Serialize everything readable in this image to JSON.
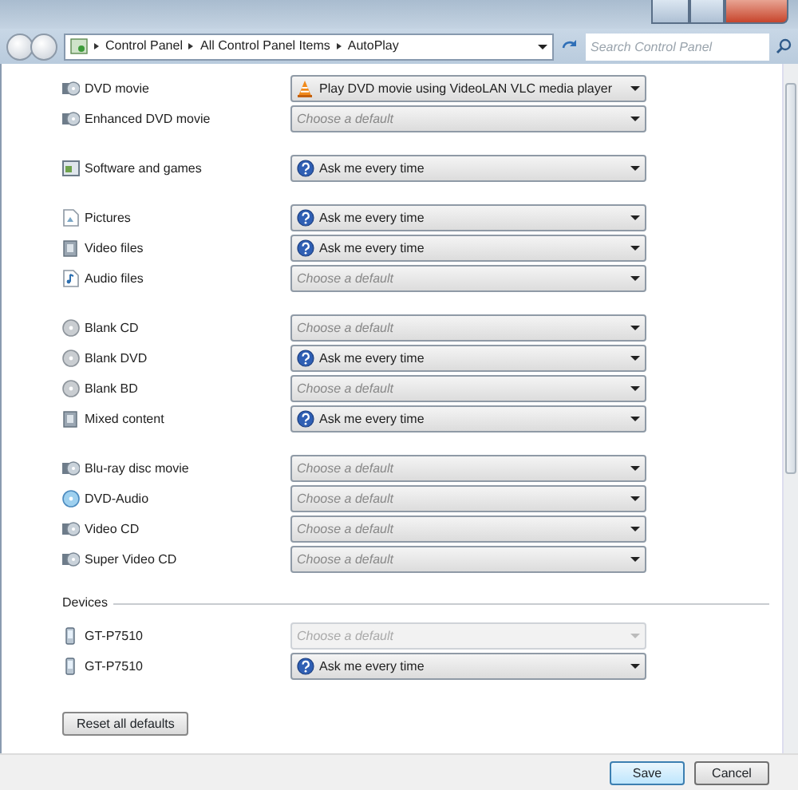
{
  "address_bar": {
    "breadcrumbs": [
      "Control Panel",
      "All Control Panel Items",
      "AutoPlay"
    ],
    "search": {
      "placeholder": "Search Control Panel"
    }
  },
  "groups": [
    {
      "items": [
        {
          "label": "DVD movie",
          "kind": "disc",
          "select": {
            "value": "Play DVD movie using VideoLAN VLC media player",
            "kind": "vlc",
            "disabled": false
          }
        },
        {
          "label": "Enhanced DVD movie",
          "kind": "disc",
          "select": {
            "placeholder": "Choose a default",
            "kind": "none",
            "disabled": false
          }
        }
      ]
    },
    {
      "items": [
        {
          "label": "Software and games",
          "kind": "software",
          "select": {
            "value": "Ask me every time",
            "kind": "ask",
            "disabled": false
          }
        }
      ]
    },
    {
      "items": [
        {
          "label": "Pictures",
          "kind": "picture",
          "select": {
            "value": "Ask me every time",
            "kind": "ask",
            "disabled": false
          }
        },
        {
          "label": "Video files",
          "kind": "video",
          "select": {
            "value": "Ask me every time",
            "kind": "ask",
            "disabled": false
          }
        },
        {
          "label": "Audio files",
          "kind": "audio",
          "select": {
            "placeholder": "Choose a default",
            "kind": "none",
            "disabled": false
          }
        }
      ]
    },
    {
      "items": [
        {
          "label": "Blank CD",
          "kind": "blank",
          "select": {
            "placeholder": "Choose a default",
            "kind": "none",
            "disabled": false
          }
        },
        {
          "label": "Blank DVD",
          "kind": "blank",
          "select": {
            "value": "Ask me every time",
            "kind": "ask",
            "disabled": false
          }
        },
        {
          "label": "Blank BD",
          "kind": "blank",
          "select": {
            "placeholder": "Choose a default",
            "kind": "none",
            "disabled": false
          }
        },
        {
          "label": "Mixed content",
          "kind": "video",
          "select": {
            "value": "Ask me every time",
            "kind": "ask",
            "disabled": false
          }
        }
      ]
    },
    {
      "items": [
        {
          "label": "Blu-ray disc movie",
          "kind": "disc",
          "select": {
            "placeholder": "Choose a default",
            "kind": "none",
            "disabled": false
          }
        },
        {
          "label": "DVD-Audio",
          "kind": "audiodisc",
          "select": {
            "placeholder": "Choose a default",
            "kind": "none",
            "disabled": false
          }
        },
        {
          "label": "Video CD",
          "kind": "disc",
          "select": {
            "placeholder": "Choose a default",
            "kind": "none",
            "disabled": false
          }
        },
        {
          "label": "Super Video CD",
          "kind": "disc",
          "select": {
            "placeholder": "Choose a default",
            "kind": "none",
            "disabled": false
          }
        }
      ]
    },
    {
      "heading": "Devices",
      "items": [
        {
          "label": "GT-P7510",
          "kind": "device",
          "select": {
            "placeholder": "Choose a default",
            "kind": "none",
            "disabled": true
          }
        },
        {
          "label": "GT-P7510",
          "kind": "device",
          "select": {
            "value": "Ask me every time",
            "kind": "ask",
            "disabled": false
          }
        }
      ]
    }
  ],
  "reset_button": "Reset all defaults",
  "footer_buttons": [
    "Save",
    "Cancel"
  ]
}
